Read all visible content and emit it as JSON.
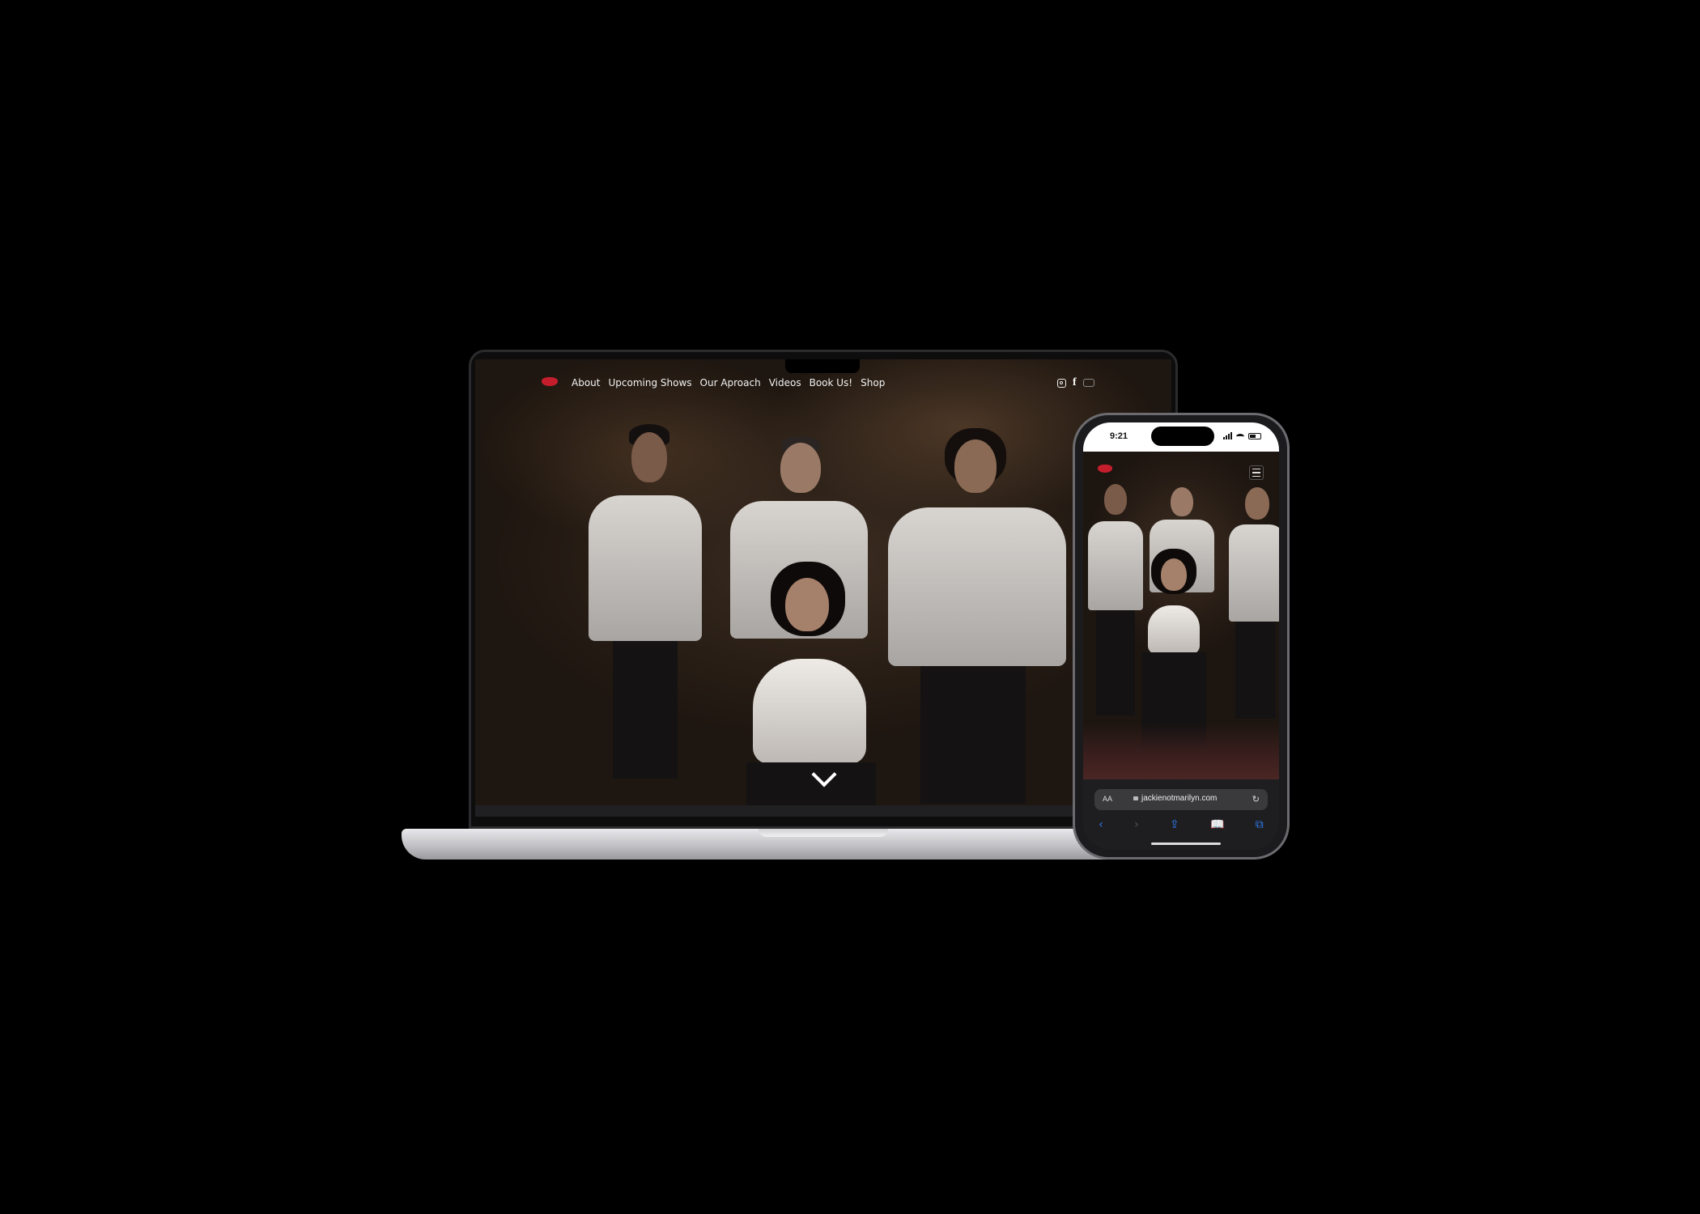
{
  "laptop": {
    "nav": {
      "links": [
        "About",
        "Upcoming Shows",
        "Our Aproach",
        "Videos",
        "Book Us!",
        "Shop"
      ],
      "social_icons": [
        "instagram-icon",
        "facebook-icon",
        "youtube-icon"
      ],
      "facebook_glyph": "f"
    },
    "scroll_indicator": "chevron-down-icon"
  },
  "phone": {
    "status": {
      "time": "9:21"
    },
    "browser": {
      "text_size_label": "AA",
      "url": "jackienotmarilyn.com",
      "reload_glyph": "↻",
      "toolbar": [
        "‹",
        "›",
        "⇪",
        "📖",
        "⧉"
      ]
    }
  },
  "colors": {
    "background": "#000000",
    "logo_red": "#c41e2c",
    "safari_blue": "#2f7bf0"
  }
}
